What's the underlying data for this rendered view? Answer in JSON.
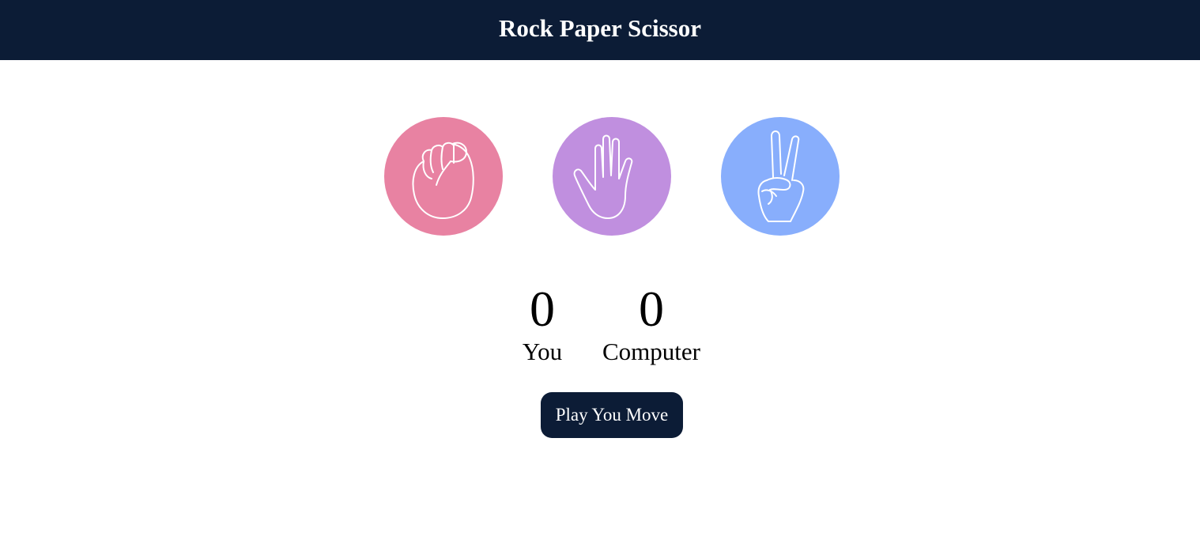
{
  "header": {
    "title": "Rock Paper Scissor"
  },
  "choices": [
    {
      "id": "rock",
      "icon": "fist-icon",
      "color": "#e882a2"
    },
    {
      "id": "paper",
      "icon": "open-hand-icon",
      "color": "#c08fdf"
    },
    {
      "id": "scissor",
      "icon": "peace-hand-icon",
      "color": "#88aefc"
    }
  ],
  "scoreboard": {
    "user": {
      "score": "0",
      "label": "You"
    },
    "computer": {
      "score": "0",
      "label": "Computer"
    }
  },
  "message": {
    "text": "Play You Move",
    "color": "#0c1c36"
  },
  "colors": {
    "header_bg": "#0c1c36",
    "text": "#000000",
    "page_bg": "#ffffff"
  }
}
